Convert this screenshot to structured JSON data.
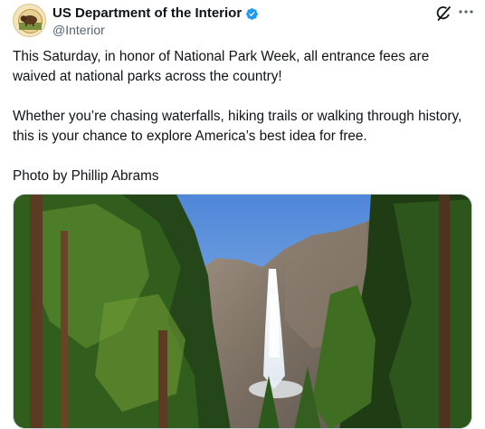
{
  "author": {
    "name": "US Department of the Interior",
    "handle": "@Interior",
    "verified_color": "#1d9bf0",
    "avatar_icon": "bison-seal-icon"
  },
  "actions": {
    "grok_icon": "grok-icon",
    "more_icon": "more-icon"
  },
  "tweet": {
    "paragraphs": [
      "This Saturday, in honor of National Park Week, all entrance fees are waived at national parks across the country!",
      "Whether you’re chasing waterfalls, hiking trails or walking through history, this is your chance to explore America’s best idea for free.",
      "Photo by Phillip Abrams"
    ]
  },
  "media": {
    "icon": "yosemite-falls-photo"
  }
}
